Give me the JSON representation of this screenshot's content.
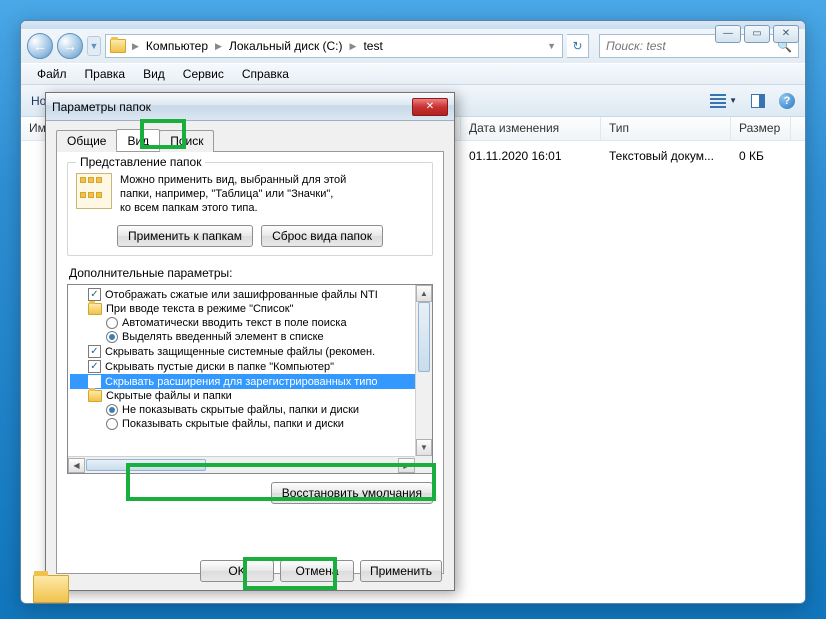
{
  "explorer": {
    "win_min": "—",
    "win_max": "▭",
    "win_close": "✕",
    "nav_back": "←",
    "nav_fwd": "→",
    "breadcrumb": [
      "Компьютер",
      "Локальный диск (C:)",
      "test"
    ],
    "refresh": "↻",
    "search_placeholder": "Поиск: test",
    "menu": {
      "file": "Файл",
      "edit": "Правка",
      "view": "Вид",
      "tools": "Сервис",
      "help": "Справка"
    },
    "toolbar_newfolder": "Новая папка",
    "columns": {
      "name": "Имя",
      "date": "Дата изменения",
      "type": "Тип",
      "size": "Размер"
    },
    "row": {
      "date": "01.11.2020 16:01",
      "type": "Текстовый докум...",
      "size": "0 КБ"
    }
  },
  "dialog": {
    "title": "Параметры папок",
    "tabs": {
      "general": "Общие",
      "view": "Вид",
      "search": "Поиск"
    },
    "group": {
      "legend": "Представление папок",
      "text1": "Можно применить вид, выбранный для этой",
      "text2": "папки, например, \"Таблица\" или \"Значки\",",
      "text3": "ко всем папкам этого типа.",
      "apply_btn": "Применить к папкам",
      "reset_btn": "Сброс вида папок"
    },
    "params_label": "Дополнительные параметры:",
    "tree": {
      "r1": "Отображать сжатые или зашифрованные файлы NTI",
      "r2": "При вводе текста в режиме \"Список\"",
      "r3": "Автоматически вводить текст в поле поиска",
      "r4": "Выделять введенный элемент в списке",
      "r5": "Скрывать защищенные системные файлы (рекомен.",
      "r6": "Скрывать пустые диски в папке \"Компьютер\"",
      "r7": "Скрывать расширения для зарегистрированных типо",
      "r8": "Скрытые файлы и папки",
      "r9": "Не показывать скрытые файлы, папки и диски",
      "r10": "Показывать скрытые файлы, папки и диски"
    },
    "restore": "Восстановить умолчания",
    "ok": "OK",
    "cancel": "Отмена",
    "apply": "Применить"
  }
}
